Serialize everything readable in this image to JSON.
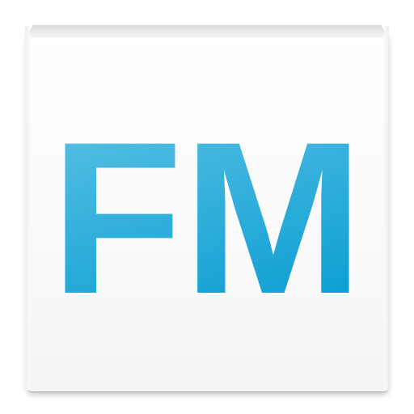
{
  "app_icon": {
    "text": "FM",
    "colors": {
      "logo_light": "#5fc3e6",
      "logo_dark": "#0fa0d3",
      "tile": "#ffffff"
    }
  }
}
